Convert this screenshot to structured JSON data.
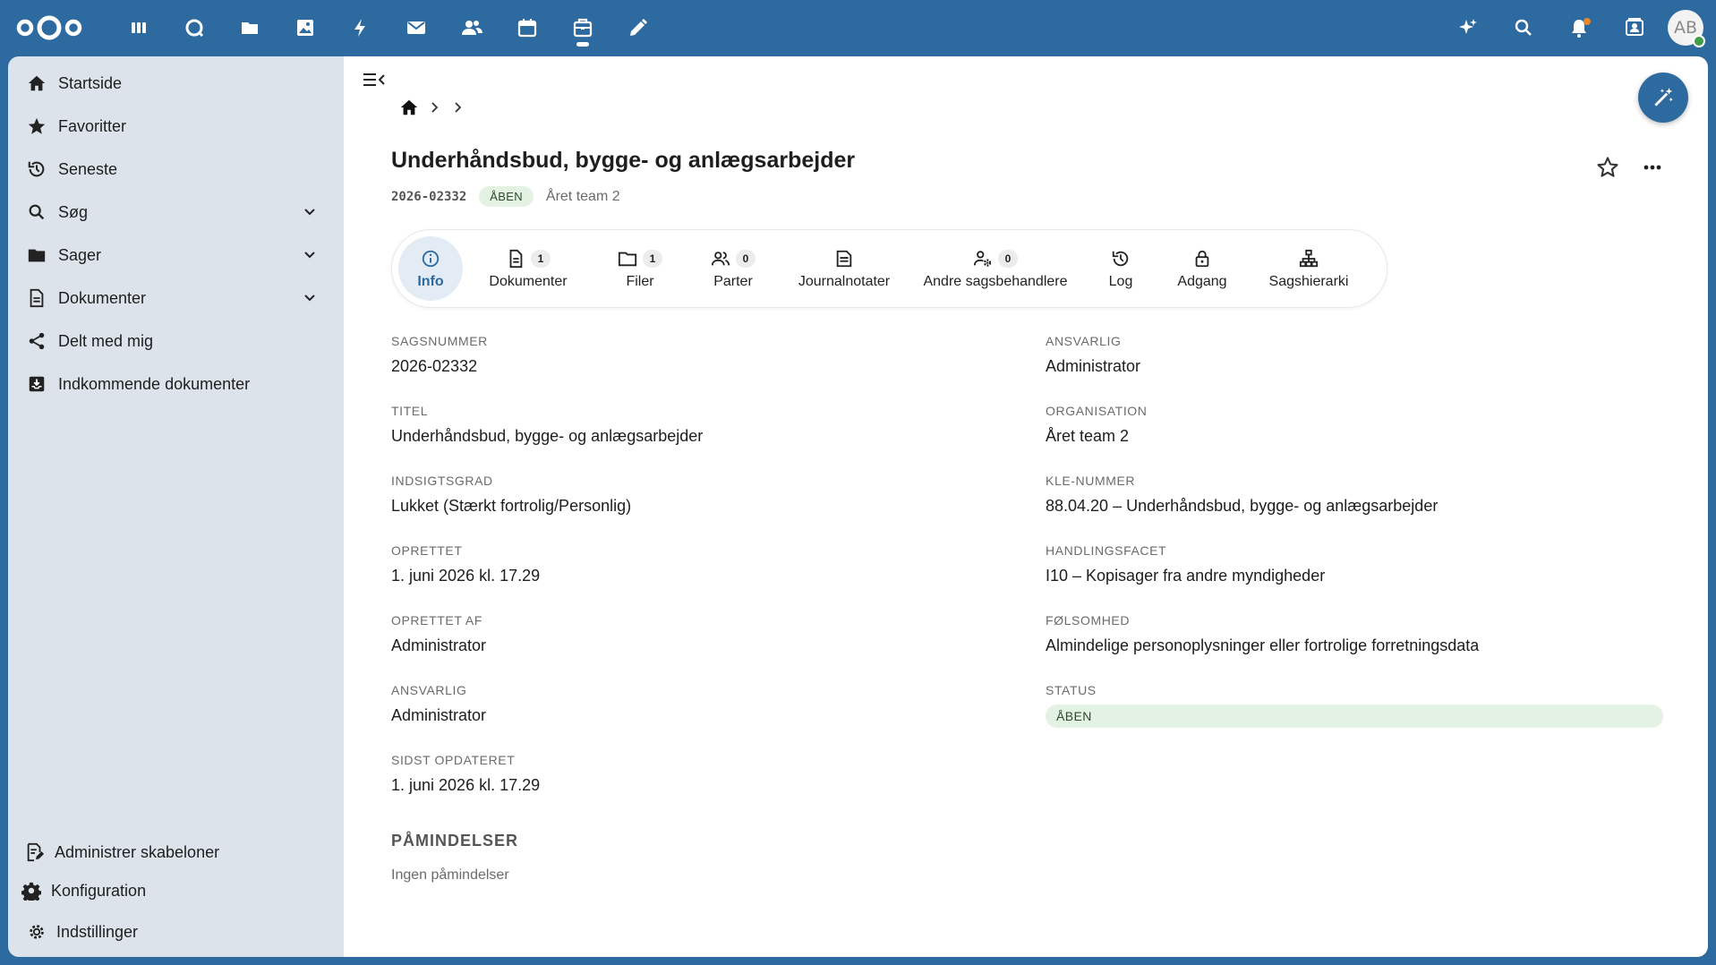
{
  "header": {
    "apps": [
      {
        "name": "dashboard",
        "icon": "dashboard-icon"
      },
      {
        "name": "talk",
        "icon": "talk-icon"
      },
      {
        "name": "files",
        "icon": "folder-icon"
      },
      {
        "name": "photos",
        "icon": "image-icon"
      },
      {
        "name": "activity",
        "icon": "lightning-icon"
      },
      {
        "name": "mail",
        "icon": "mail-icon"
      },
      {
        "name": "contacts",
        "icon": "contacts-icon"
      },
      {
        "name": "calendar",
        "icon": "calendar-icon"
      },
      {
        "name": "cases",
        "icon": "briefcase-icon",
        "active": true
      },
      {
        "name": "notes",
        "icon": "pencil-icon"
      }
    ],
    "avatar_initials": "AB",
    "accent": "#2d6aa0"
  },
  "sidebar": {
    "items": [
      {
        "label": "Startside",
        "icon": "home-icon"
      },
      {
        "label": "Favoritter",
        "icon": "star-icon"
      },
      {
        "label": "Seneste",
        "icon": "history-icon"
      },
      {
        "label": "Søg",
        "icon": "search-icon",
        "expandable": true
      },
      {
        "label": "Sager",
        "icon": "folder-icon",
        "expandable": true
      },
      {
        "label": "Dokumenter",
        "icon": "document-icon",
        "expandable": true
      },
      {
        "label": "Delt med mig",
        "icon": "share-icon"
      },
      {
        "label": "Indkommende dokumenter",
        "icon": "inbox-icon"
      }
    ],
    "bottom": {
      "templates": "Administrer skabeloner",
      "config": "Konfiguration",
      "settings": "Indstillinger"
    }
  },
  "case": {
    "title": "Underhåndsbud, bygge- og anlægsarbejder",
    "number": "2026-02332",
    "status_badge": "ÅBEN",
    "organisation": "Året team 2"
  },
  "tabs": [
    {
      "label": "Info",
      "icon": "info-icon",
      "active": true
    },
    {
      "label": "Dokumenter",
      "icon": "document-icon",
      "count": "1"
    },
    {
      "label": "Filer",
      "icon": "folder-outline-icon",
      "count": "1"
    },
    {
      "label": "Parter",
      "icon": "people-icon",
      "count": "0"
    },
    {
      "label": "Journalnotater",
      "icon": "note-icon"
    },
    {
      "label": "Andre sagsbehandlere",
      "icon": "user-gear-icon",
      "count": "0"
    },
    {
      "label": "Log",
      "icon": "history-icon"
    },
    {
      "label": "Adgang",
      "icon": "lock-icon"
    },
    {
      "label": "Sagshierarki",
      "icon": "hierarchy-icon"
    }
  ],
  "fields_left": [
    {
      "label": "SAGSNUMMER",
      "value": "2026-02332"
    },
    {
      "label": "TITEL",
      "value": "Underhåndsbud, bygge- og anlægsarbejder"
    },
    {
      "label": "INDSIGTSGRAD",
      "value": "Lukket (Stærkt fortrolig/Personlig)"
    },
    {
      "label": "OPRETTET",
      "value": "1. juni 2026 kl. 17.29"
    },
    {
      "label": "OPRETTET AF",
      "value": "Administrator"
    },
    {
      "label": "ANSVARLIG",
      "value": "Administrator"
    },
    {
      "label": "SIDST OPDATERET",
      "value": "1. juni 2026 kl. 17.29"
    }
  ],
  "fields_right": [
    {
      "label": "ANSVARLIG",
      "value": "Administrator"
    },
    {
      "label": "ORGANISATION",
      "value": "Året team 2"
    },
    {
      "label": "KLE-NUMMER",
      "value": "88.04.20 – Underhåndsbud, bygge- og anlægsarbejder"
    },
    {
      "label": "HANDLINGSFACET",
      "value": "I10 – Kopisager fra andre myndigheder"
    },
    {
      "label": "FØLSOMHED",
      "value": "Almindelige personoplysninger eller fortrolige forretningsdata"
    },
    {
      "label": "STATUS",
      "value": "ÅBEN"
    }
  ],
  "reminders": {
    "title": "PÅMINDELSER",
    "empty": "Ingen påmindelser"
  }
}
